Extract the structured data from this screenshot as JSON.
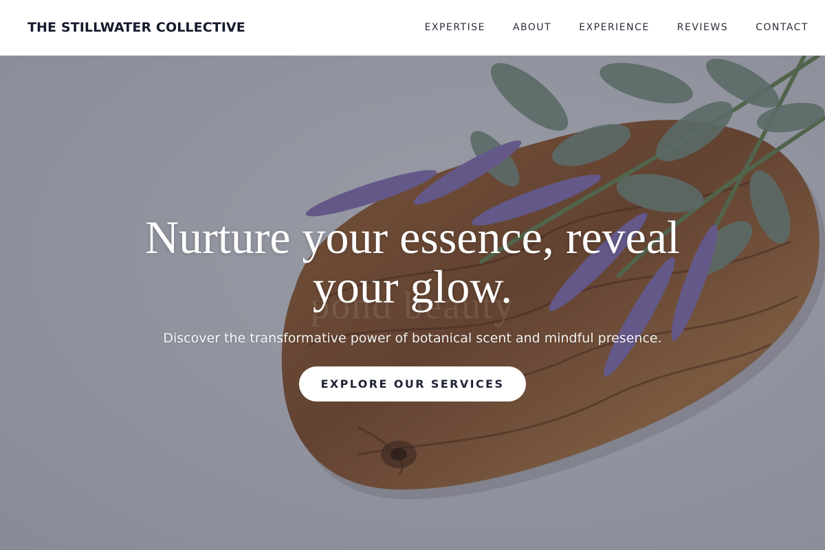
{
  "header": {
    "brand": "THE STILLWATER COLLECTIVE",
    "nav": [
      "EXPERTISE",
      "ABOUT",
      "EXPERIENCE",
      "REVIEWS",
      "CONTACT"
    ]
  },
  "hero": {
    "title": "Nurture your essence, reveal your glow.",
    "subtitle": "Discover the transformative power of botanical scent and mindful presence.",
    "cta_label": "EXPLORE OUR SERVICES",
    "watermark_text": "pond beauty"
  },
  "colors": {
    "brand_text": "#141a2b",
    "nav_text": "#2a2f3a",
    "overlay": "#1c2034",
    "cta_bg": "#ffffff",
    "cta_text": "#1d2333"
  }
}
